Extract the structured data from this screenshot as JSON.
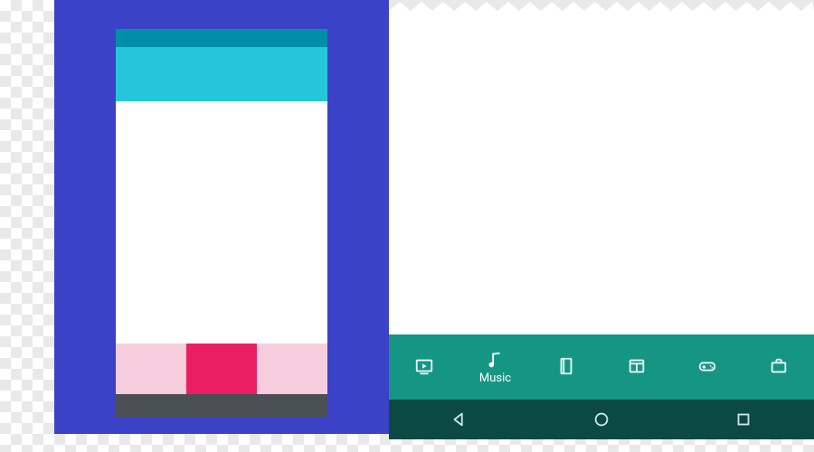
{
  "nav": {
    "items": [
      {
        "name": "video",
        "label": ""
      },
      {
        "name": "music",
        "label": "Music"
      },
      {
        "name": "books",
        "label": ""
      },
      {
        "name": "news",
        "label": ""
      },
      {
        "name": "games",
        "label": ""
      },
      {
        "name": "work",
        "label": ""
      }
    ],
    "active_index": 1
  },
  "system_bar": {
    "back": "back",
    "home": "home",
    "recents": "recents"
  },
  "colors": {
    "panel_blue": "#3b42c7",
    "top_teal": "#008ea8",
    "top_cyan": "#26c6da",
    "accent_pink": "#e91e63",
    "pale_pink": "#f6cddd",
    "bottom_dark": "#4a4e55",
    "nav_teal": "#159684",
    "sys_dark": "#0b4a43"
  }
}
